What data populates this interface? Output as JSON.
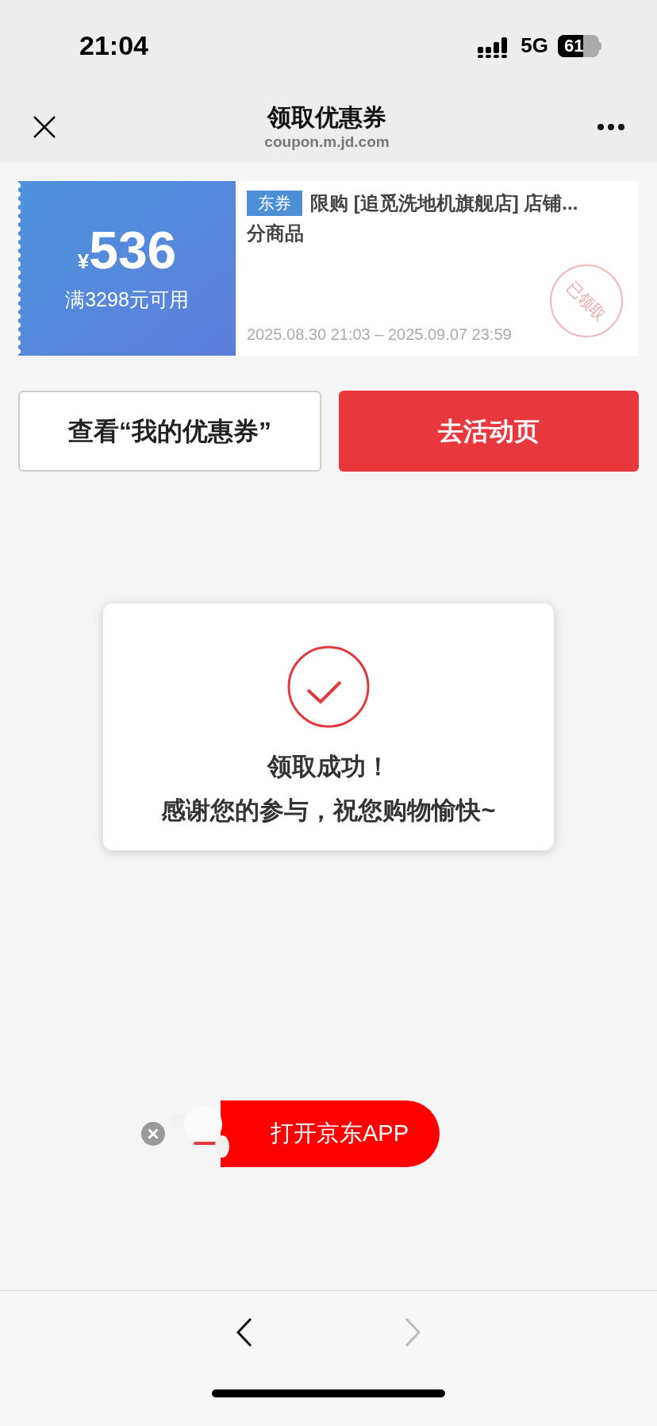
{
  "status_bar": {
    "time": "21:04",
    "network": "5G",
    "battery": "61"
  },
  "nav": {
    "title": "领取优惠券",
    "url": "coupon.m.jd.com"
  },
  "coupon": {
    "currency": "¥",
    "amount": "536",
    "condition": "满3298元可用",
    "tag": "东券",
    "title_lines": [
      "限购 [追觅洗地机旗舰店] 店铺...",
      "分商品"
    ],
    "validity": "2025.08.30 21:03 – 2025.09.07 23:59",
    "stamp": "已领取"
  },
  "buttons": [
    {
      "label": "查看“我的优惠券”",
      "kind": "outline"
    },
    {
      "label": "去活动页",
      "kind": "primary"
    }
  ],
  "dialog": {
    "title": "领取成功！",
    "message": "感谢您的参与，祝您购物愉快~"
  },
  "app_banner": {
    "label": "打开京东APP"
  },
  "toolbar": {
    "back_disabled": false,
    "forward_disabled": true
  }
}
